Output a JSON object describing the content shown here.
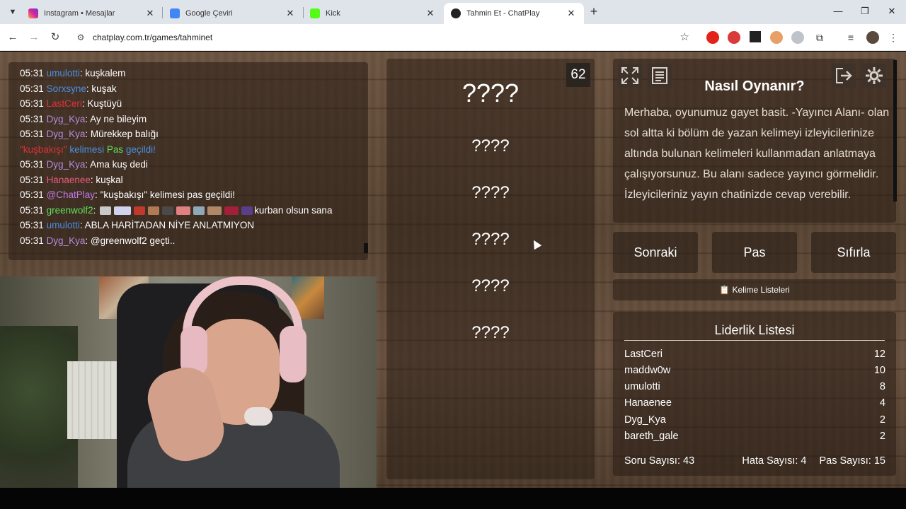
{
  "browser": {
    "tabs": [
      {
        "title": "Instagram • Mesajlar",
        "color": "#d6249f"
      },
      {
        "title": "Google Çeviri",
        "color": "#4285f4"
      },
      {
        "title": "Kick",
        "color": "#53fc18"
      },
      {
        "title": "Tahmin Et - ChatPlay",
        "color": "#222222"
      }
    ],
    "url": "chatplay.com.tr/games/tahminet"
  },
  "chat": {
    "messages": [
      {
        "time": "05:31",
        "user": "umulotti",
        "user_color": "#4a90e2",
        "sep": ": ",
        "text": "kuşkalem"
      },
      {
        "time": "05:31",
        "user": "Sorxsyne",
        "user_color": "#4a90e2",
        "sep": ": ",
        "text": "kuşak"
      },
      {
        "time": "05:31",
        "user": "LastCeri",
        "user_color": "#e0303a",
        "sep": ": ",
        "text": "Kuştüyü"
      },
      {
        "time": "05:31",
        "user": "Dyg_Kya",
        "user_color": "#b58cdf",
        "sep": ": ",
        "text": "Ay ne bileyim"
      },
      {
        "time": "05:31",
        "user": "Dyg_Kya",
        "user_color": "#b58cdf",
        "sep": ": ",
        "text": "Mürekkep balığı"
      },
      {
        "time": "",
        "user": "\"kuşbakışı\"",
        "user_color": "#e0303a",
        "sep": " kelimesi ",
        "text": ""
      },
      {
        "time": "05:31",
        "user": "Dyg_Kya",
        "user_color": "#b58cdf",
        "sep": ": ",
        "text": "Ama kuş dedi"
      },
      {
        "time": "05:31",
        "user": "Hanaenee",
        "user_color": "#e85a7c",
        "sep": ": ",
        "text": "kuşkal"
      },
      {
        "time": "05:31",
        "user": "@ChatPlay",
        "user_color": "#c27be8",
        "sep": ": ",
        "text": "\"kuşbakışı\" kelimesi pas geçildi!"
      },
      {
        "time": "05:31",
        "user": "greenwolf2",
        "user_color": "#5ee05a",
        "sep": ": ",
        "text": "kurban olsun sana"
      },
      {
        "time": "05:31",
        "user": "umulotti",
        "user_color": "#4a90e2",
        "sep": ": ",
        "text": "ABLA HARİTADAN NİYE ANLATMIYON"
      },
      {
        "time": "05:31",
        "user": "Dyg_Kya",
        "user_color": "#b58cdf",
        "sep": ": ",
        "text": "@greenwolf2 geçti.."
      }
    ],
    "pass_notice": {
      "word": "\"kuşbakışı\"",
      "mid": " kelimesi ",
      "pas": "Pas",
      "end": " geçildi!"
    }
  },
  "game": {
    "counter": "62",
    "words": [
      "????",
      "????",
      "????",
      "????",
      "????",
      "????"
    ]
  },
  "howto": {
    "title": "Nasıl Oynanır?",
    "text": "Merhaba, oyunumuz gayet basit. -Yayıncı Alanı- olan sol altta ki bölüm de yazan kelimeyi izleyicilerinize altında bulunan kelimeleri kullanmadan anlatmaya çalışıyorsunuz. Bu alanı sadece yayıncı görmelidir. İzleyicileriniz yayın chatinizde cevap verebilir."
  },
  "actions": {
    "next": "Sonraki",
    "pass": "Pas",
    "reset": "Sıfırla",
    "word_lists": "Kelime Listeleri"
  },
  "leaderboard": {
    "title": "Liderlik Listesi",
    "rows": [
      {
        "name": "LastCeri",
        "score": "12"
      },
      {
        "name": "maddw0w",
        "score": "10"
      },
      {
        "name": "umulotti",
        "score": "8"
      },
      {
        "name": "Hanaenee",
        "score": "4"
      },
      {
        "name": "Dyg_Kya",
        "score": "2"
      },
      {
        "name": "bareth_gale",
        "score": "2"
      }
    ],
    "stats": {
      "questions": "Soru Sayısı: 43",
      "errors": "Hata Sayısı: 4",
      "passes": "Pas Sayısı: 15"
    }
  }
}
